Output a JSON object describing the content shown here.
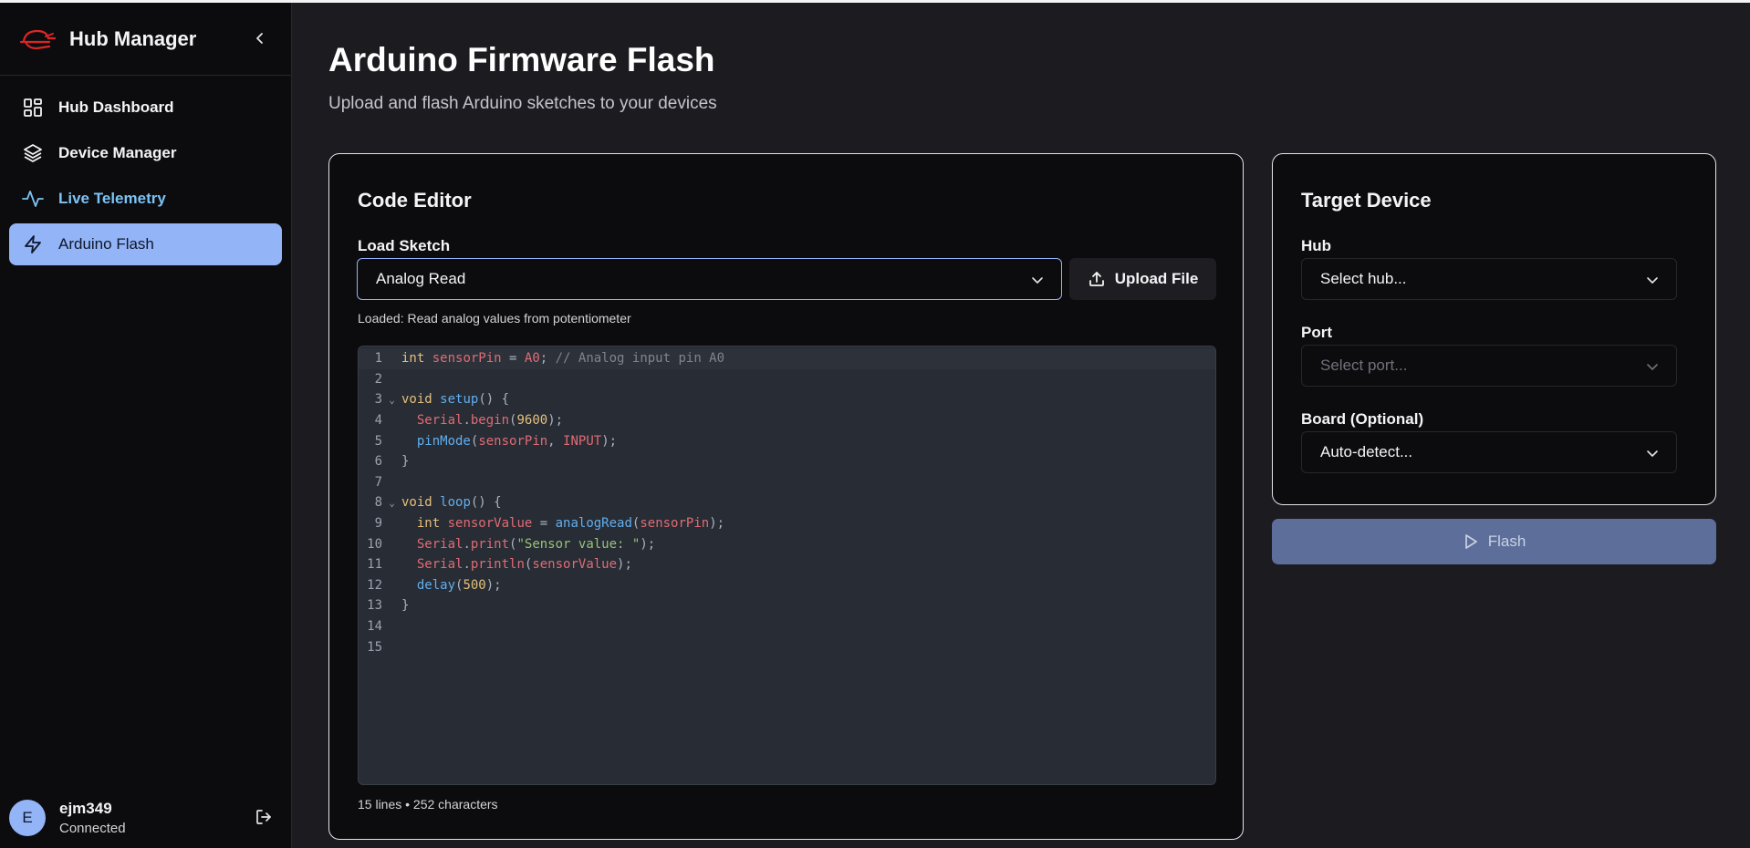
{
  "app": {
    "title": "Hub Manager"
  },
  "sidebar": {
    "items": [
      {
        "label": "Hub Dashboard",
        "icon": "layout-grid-icon"
      },
      {
        "label": "Device Manager",
        "icon": "layers-icon"
      },
      {
        "label": "Live Telemetry",
        "icon": "activity-icon"
      },
      {
        "label": "Arduino Flash",
        "icon": "zap-icon",
        "active": true
      }
    ]
  },
  "user": {
    "initial": "E",
    "name": "ejm349",
    "status": "Connected"
  },
  "page": {
    "title": "Arduino Firmware Flash",
    "subtitle": "Upload and flash Arduino sketches to your devices"
  },
  "editor_card": {
    "title": "Code Editor",
    "load_label": "Load Sketch",
    "sketch_value": "Analog Read",
    "upload_label": "Upload File",
    "loaded_note": "Loaded: Read analog values from potentiometer",
    "stats": "15 lines • 252 characters",
    "lines": [
      "int sensorPin = A0; // Analog input pin A0",
      "",
      "void setup() {",
      "  Serial.begin(9600);",
      "  pinMode(sensorPin, INPUT);",
      "}",
      "",
      "void loop() {",
      "  int sensorValue = analogRead(sensorPin);",
      "  Serial.print(\"Sensor value: \");",
      "  Serial.println(sensorValue);",
      "  delay(500);",
      "}",
      "",
      ""
    ]
  },
  "target_card": {
    "title": "Target Device",
    "hub_label": "Hub",
    "hub_placeholder": "Select hub...",
    "port_label": "Port",
    "port_placeholder": "Select port...",
    "board_label": "Board (Optional)",
    "board_value": "Auto-detect..."
  },
  "flash_label": "Flash",
  "colors": {
    "accent": "#93b4f7",
    "telemetry": "#7cc3f5",
    "flash_button": "#5c6e99",
    "brand_logo": "#dc2626"
  }
}
